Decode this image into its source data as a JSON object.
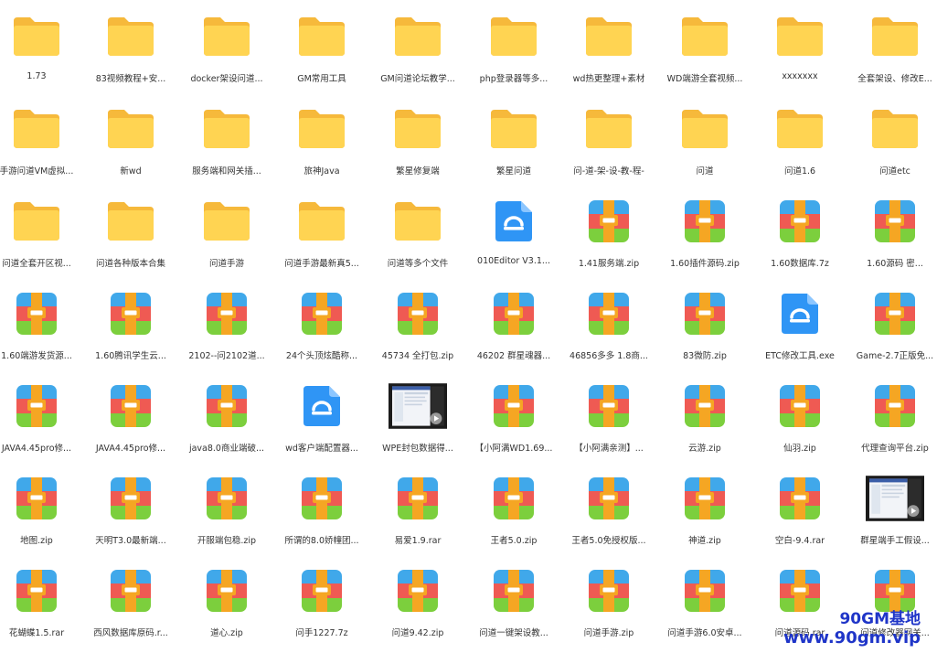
{
  "rows": [
    [
      {
        "type": "folder",
        "label": "1.73"
      },
      {
        "type": "folder",
        "label": "83视频教程+安..."
      },
      {
        "type": "folder",
        "label": "docker架设问道..."
      },
      {
        "type": "folder",
        "label": "GM常用工具"
      },
      {
        "type": "folder",
        "label": "GM问道论坛教学..."
      },
      {
        "type": "folder",
        "label": "php登录器等多..."
      },
      {
        "type": "folder",
        "label": "wd热更整理+素材"
      },
      {
        "type": "folder",
        "label": "WD端游全套视频..."
      },
      {
        "type": "folder",
        "label": "xxxxxxx"
      },
      {
        "type": "folder",
        "label": "全套架设、修改E..."
      }
    ],
    [
      {
        "type": "folder",
        "label": "手游问道VM虚拟..."
      },
      {
        "type": "folder",
        "label": "新wd"
      },
      {
        "type": "folder",
        "label": "服务端和网关插..."
      },
      {
        "type": "folder",
        "label": "旅神Java"
      },
      {
        "type": "folder",
        "label": "繁星修复端"
      },
      {
        "type": "folder",
        "label": "繁星问道"
      },
      {
        "type": "folder",
        "label": "问-道-架-设-教-程-"
      },
      {
        "type": "folder",
        "label": "问道"
      },
      {
        "type": "folder",
        "label": "问道1.6"
      },
      {
        "type": "folder",
        "label": "问道etc"
      }
    ],
    [
      {
        "type": "folder",
        "label": "问道全套开区视..."
      },
      {
        "type": "folder",
        "label": "问道各种版本合集"
      },
      {
        "type": "folder",
        "label": "问道手游"
      },
      {
        "type": "folder",
        "label": "问道手游最新真5..."
      },
      {
        "type": "folder",
        "label": "问道等多个文件"
      },
      {
        "type": "exe",
        "label": "010Editor V3.1..."
      },
      {
        "type": "archive",
        "label": "1.41服务端.zip"
      },
      {
        "type": "archive",
        "label": "1.60插件源码.zip"
      },
      {
        "type": "archive",
        "label": "1.60数据库.7z"
      },
      {
        "type": "archive",
        "label": "1.60源码      密..."
      }
    ],
    [
      {
        "type": "archive",
        "label": "1.60端游发货源..."
      },
      {
        "type": "archive",
        "label": "1.60腾讯学生云..."
      },
      {
        "type": "archive",
        "label": "2102--问2102道..."
      },
      {
        "type": "archive",
        "label": "24个头顶炫酷称..."
      },
      {
        "type": "archive",
        "label": "45734 全打包.zip"
      },
      {
        "type": "archive",
        "label": "46202 群星魂器..."
      },
      {
        "type": "archive",
        "label": "46856多多 1.8商..."
      },
      {
        "type": "archive",
        "label": "83微防.zip"
      },
      {
        "type": "exe",
        "label": "ETC修改工具.exe"
      },
      {
        "type": "archive",
        "label": "Game-2.7正版免..."
      }
    ],
    [
      {
        "type": "archive",
        "label": "JAVA4.45pro修..."
      },
      {
        "type": "archive",
        "label": "JAVA4.45pro修..."
      },
      {
        "type": "archive",
        "label": "java8.0商业端破..."
      },
      {
        "type": "exe",
        "label": "wd客户端配置器..."
      },
      {
        "type": "video",
        "label": "WPE封包数据得..."
      },
      {
        "type": "archive",
        "label": "【小阿满WD1.69..."
      },
      {
        "type": "archive",
        "label": "【小阿满亲测】..."
      },
      {
        "type": "archive",
        "label": "云游.zip"
      },
      {
        "type": "archive",
        "label": "仙羽.zip"
      },
      {
        "type": "archive",
        "label": "代理查询平台.zip"
      }
    ],
    [
      {
        "type": "archive",
        "label": "地图.zip"
      },
      {
        "type": "archive",
        "label": "天明T3.0最新端..."
      },
      {
        "type": "archive",
        "label": "开服端包稳.zip"
      },
      {
        "type": "archive",
        "label": "所谓的8.0娇幢团..."
      },
      {
        "type": "archive",
        "label": "易爱1.9.rar"
      },
      {
        "type": "archive",
        "label": "王者5.0.zip"
      },
      {
        "type": "archive",
        "label": "王者5.0免授权版..."
      },
      {
        "type": "archive",
        "label": "神道.zip"
      },
      {
        "type": "archive",
        "label": "空白-9.4.rar"
      },
      {
        "type": "video",
        "label": "群星端手工假设..."
      }
    ],
    [
      {
        "type": "archive",
        "label": "花蝴蝶1.5.rar"
      },
      {
        "type": "archive",
        "label": "西风数据库原码.r..."
      },
      {
        "type": "archive",
        "label": "道心.zip"
      },
      {
        "type": "archive",
        "label": "问手1227.7z"
      },
      {
        "type": "archive",
        "label": "问道9.42.zip"
      },
      {
        "type": "archive",
        "label": "问道一键架设教..."
      },
      {
        "type": "archive",
        "label": "问道手游.zip"
      },
      {
        "type": "archive",
        "label": "问道手游6.0安卓..."
      },
      {
        "type": "archive",
        "label": "问道源码.rar"
      },
      {
        "type": "archive",
        "label": "问道修改器网关..."
      }
    ]
  ],
  "watermark": {
    "line1": "90GM基地",
    "line2": "www.90gm.vip",
    "color": "#1f35c8"
  },
  "colors": {
    "folder_back": "#f6b93b",
    "folder_front": "#ffd452",
    "exe_bg": "#2f95f5",
    "archive_top": "#40a8ea",
    "archive_mid": "#ef5a53",
    "archive_bottom": "#7ccf3d",
    "archive_band": "#f5a623"
  }
}
